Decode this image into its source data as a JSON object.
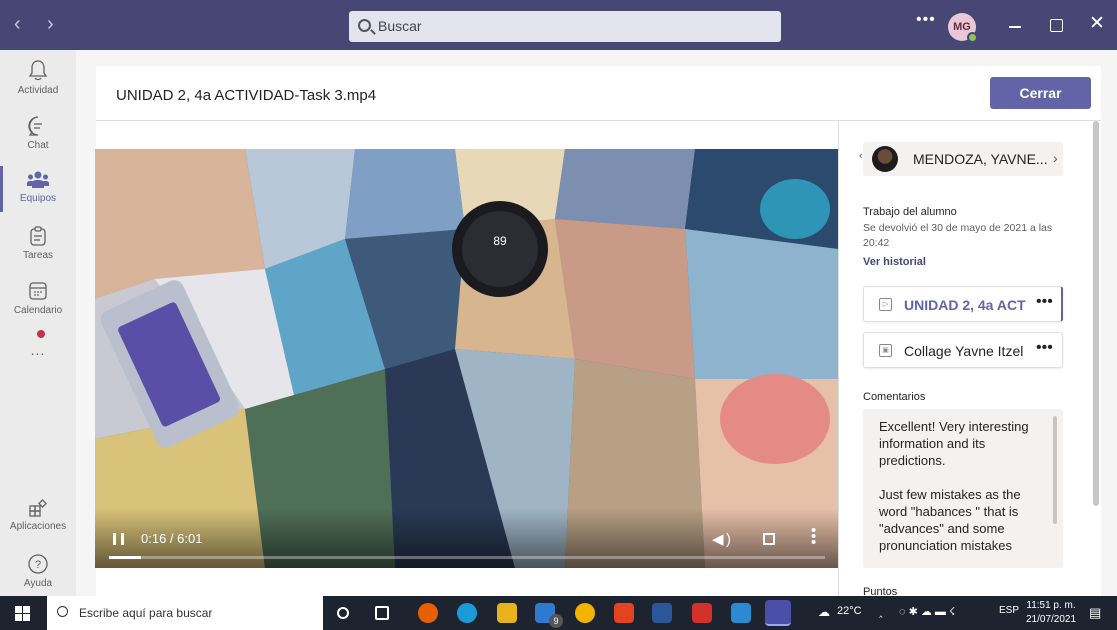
{
  "titlebar": {
    "back_icon": "chevron-left-icon",
    "forward_icon": "chevron-right-icon",
    "search_placeholder": "Buscar",
    "more_icon": "ellipsis-icon",
    "avatar_initials": "MG"
  },
  "rail": {
    "items": [
      {
        "label": "Actividad",
        "icon": "bell-icon"
      },
      {
        "label": "Chat",
        "icon": "chat-icon"
      },
      {
        "label": "Equipos",
        "icon": "teams-icon"
      },
      {
        "label": "Tareas",
        "icon": "assignments-icon"
      },
      {
        "label": "Calendario",
        "icon": "calendar-icon"
      },
      {
        "label": "Aplicaciones",
        "icon": "apps-icon"
      },
      {
        "label": "Ayuda",
        "icon": "help-icon"
      }
    ],
    "more_label": "...",
    "active_color": "#6264a7"
  },
  "header": {
    "file_title": "UNIDAD 2, 4a ACTIVIDAD-Task 3.mp4",
    "close_label": "Cerrar"
  },
  "video": {
    "time_display": "0:16 / 6:01",
    "progress_fraction": 0.044
  },
  "panel": {
    "student_name": "MENDOZA, YAVNE...",
    "work_title": "Trabajo del alumno",
    "returned_text": "Se devolvió el 30 de mayo de 2021 a las 20:42",
    "history_link": "Ver historial",
    "attachments": [
      {
        "label": "UNIDAD 2, 4a ACT",
        "selected": true
      },
      {
        "label": "Collage Yavne Itzel",
        "selected": false
      }
    ],
    "comments_title": "Comentarios",
    "comment_paragraphs": [
      "Excellent! Very interesting information and its predictions.",
      "Just few mistakes as the word \"habances \" that is \"advances\" and some pronunciation mistakes"
    ],
    "points_title": "Puntos"
  },
  "taskbar": {
    "search_placeholder": "Escribe aquí para buscar",
    "mail_badge": "9",
    "temperature": "22°C",
    "language": "ESP",
    "time": "11:51 p. m.",
    "date": "21/07/2021"
  },
  "colors": {
    "titlebar": "#464775",
    "accent": "#6264a7",
    "taskbar": "#1d2430"
  }
}
